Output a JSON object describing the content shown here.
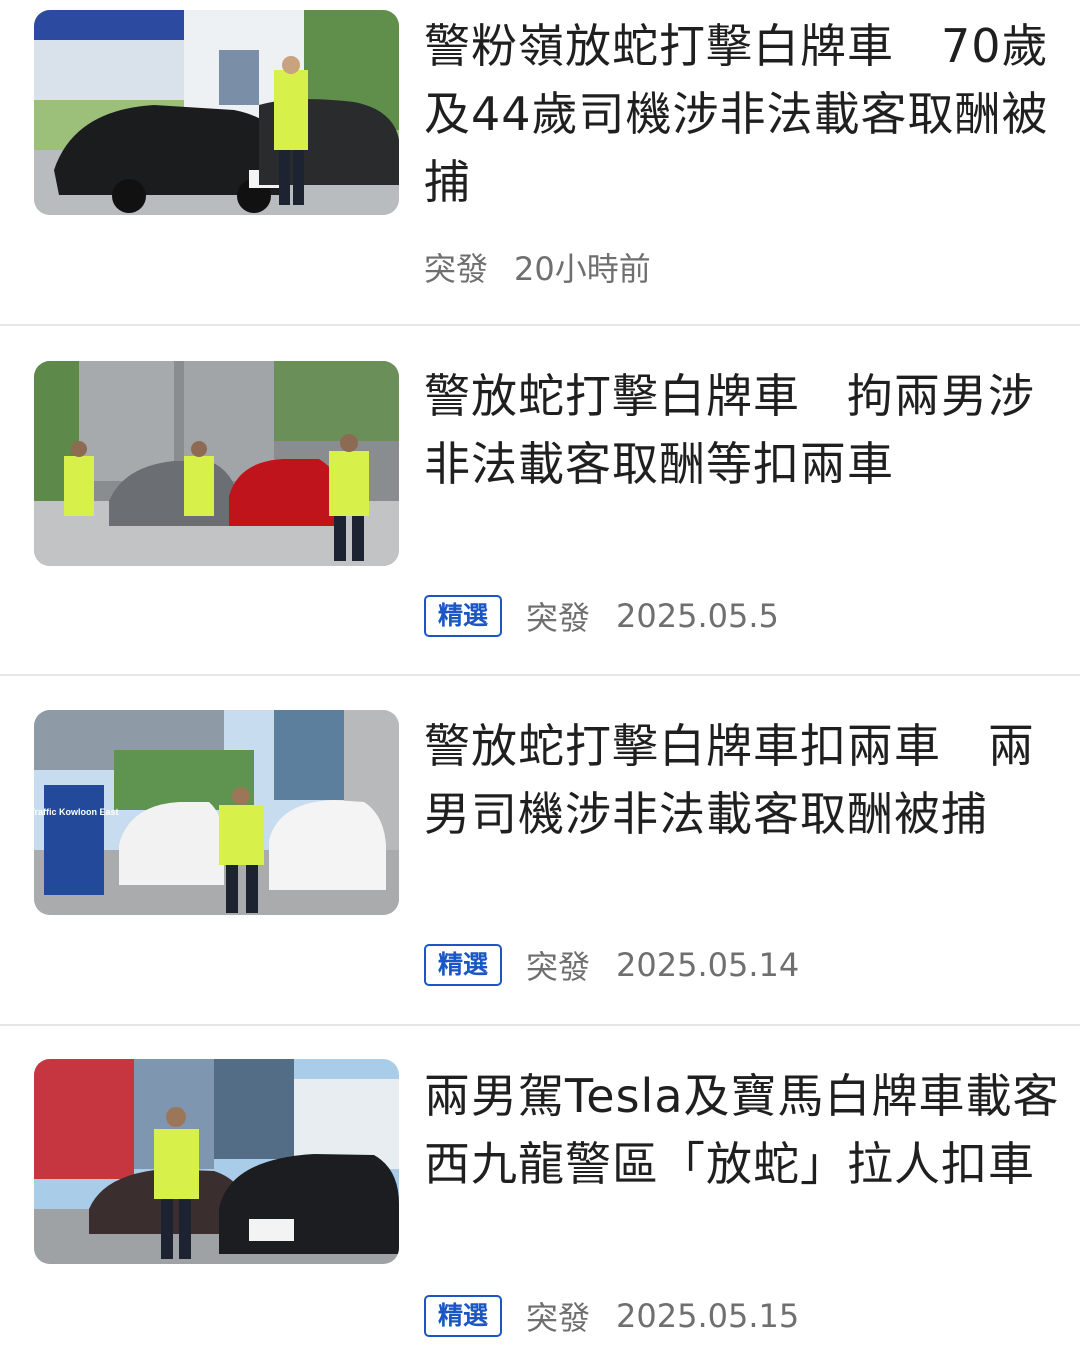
{
  "articles": [
    {
      "title": "警粉嶺放蛇打擊白牌車　70歲及44歲司機涉非法載客取酬被捕",
      "badge": "",
      "category": "突發",
      "time": "20小時前",
      "thumb_sign": "",
      "thumb_alt": "police officer with black car and white car"
    },
    {
      "title": "警放蛇打擊白牌車　拘兩男涉非法載客取酬等扣兩車",
      "badge": "精選",
      "category": "突發",
      "time": "2025.05.5",
      "thumb_sign": "",
      "thumb_alt": "three officers beside grey and red cars"
    },
    {
      "title": "警放蛇打擊白牌車扣兩車　兩男司機涉非法載客取酬被捕",
      "badge": "精選",
      "category": "突發",
      "time": "2025.05.14",
      "thumb_sign": "Traffic Kowloon East",
      "thumb_alt": "officer between two white cars"
    },
    {
      "title": "兩男駕Tesla及寶馬白牌車載客　西九龍警區「放蛇」拉人扣車",
      "badge": "精選",
      "category": "突發",
      "time": "2025.05.15",
      "thumb_sign": "",
      "thumb_alt": "officer beside two dark cars"
    }
  ],
  "colors": {
    "badge_blue": "#1a56c4",
    "meta_gray": "#6f6f6f",
    "title_dark": "#1f1f1f",
    "divider": "#e6e6e6"
  }
}
